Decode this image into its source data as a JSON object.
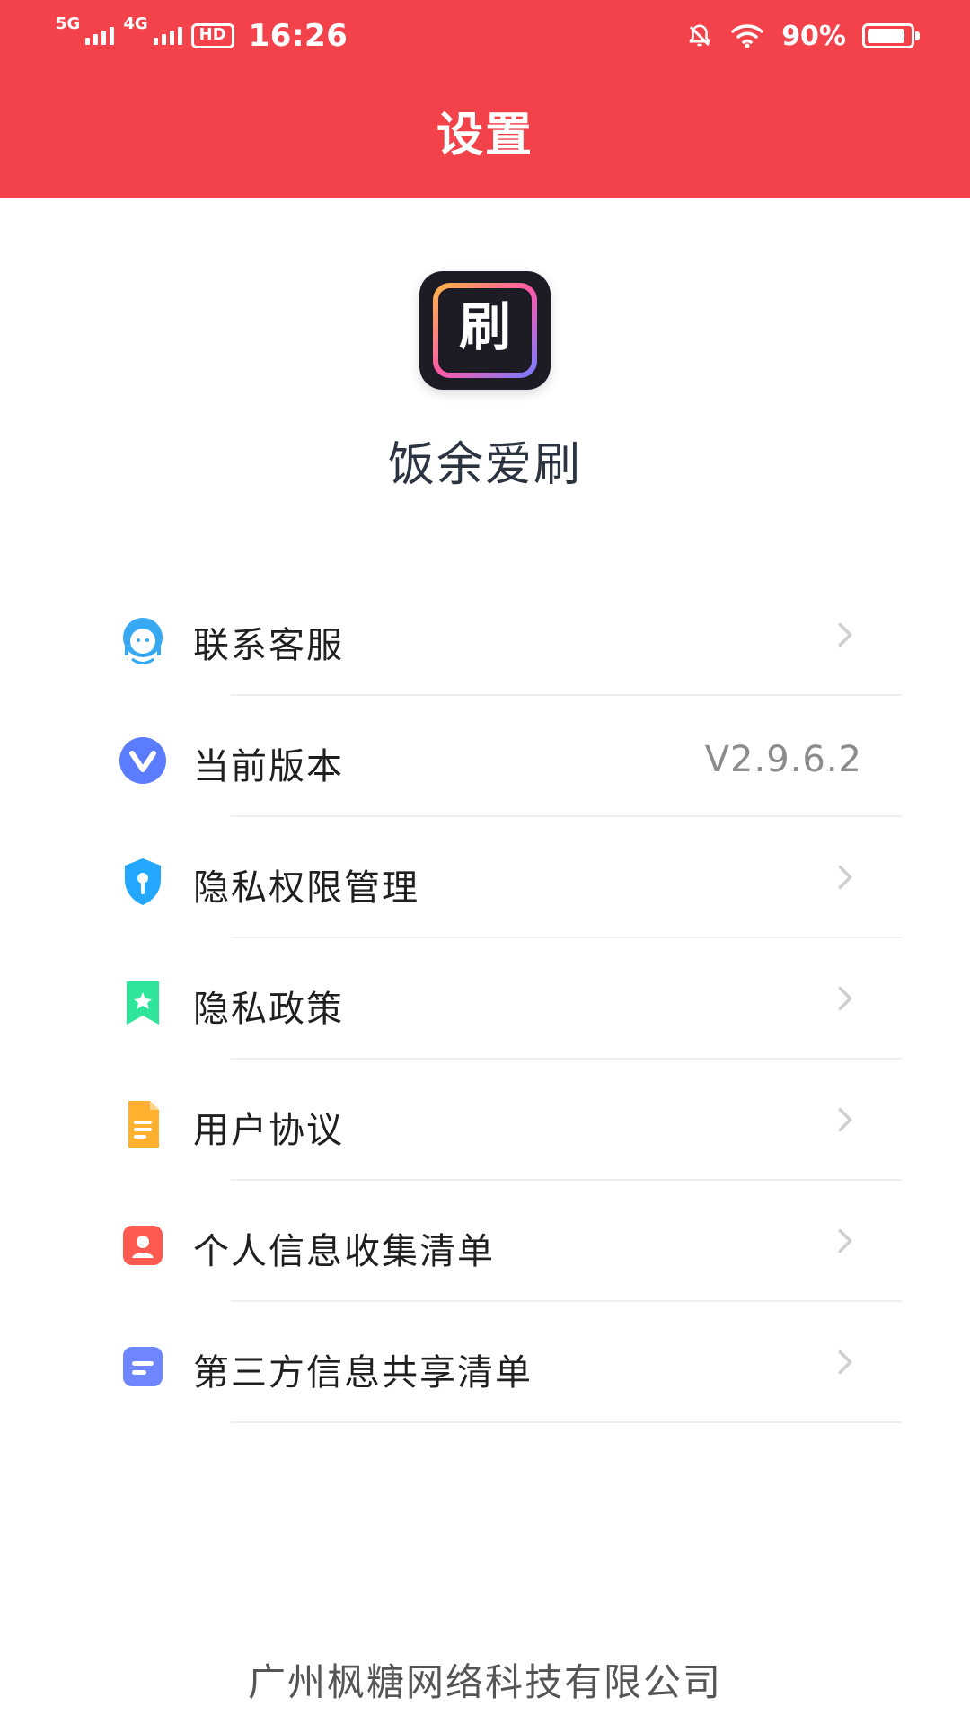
{
  "status_bar": {
    "signal1": "5G",
    "signal2": "4G",
    "hd_badge": "HD",
    "time": "16:26",
    "battery_percent": "90%",
    "battery_level": 0.9,
    "icons": [
      "mute-bell-icon",
      "wifi-icon",
      "battery-icon"
    ]
  },
  "header": {
    "title": "设置"
  },
  "app": {
    "logo_glyph": "刷",
    "name": "饭余爱刷"
  },
  "menu": {
    "items": [
      {
        "label": "联系客服",
        "icon": "customer-service-icon"
      },
      {
        "label": "当前版本",
        "value": "V2.9.6.2",
        "icon": "version-icon"
      },
      {
        "label": "隐私权限管理",
        "icon": "privacy-permission-icon"
      },
      {
        "label": "隐私政策",
        "icon": "privacy-policy-icon"
      },
      {
        "label": "用户协议",
        "icon": "user-agreement-icon"
      },
      {
        "label": "个人信息收集清单",
        "icon": "personal-info-icon"
      },
      {
        "label": "第三方信息共享清单",
        "icon": "third-party-share-icon"
      }
    ]
  },
  "footer": {
    "company": "广州枫糖网络科技有限公司"
  },
  "colors": {
    "header_bg": "#f4424b",
    "text_primary": "#1f1f1f",
    "text_secondary": "#8b8b8b"
  }
}
